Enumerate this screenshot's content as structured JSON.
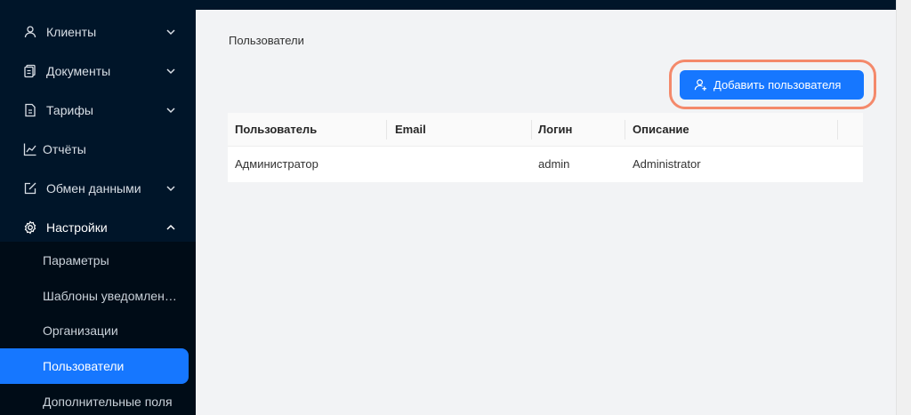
{
  "sidebar": {
    "items": [
      {
        "label": "Клиенты",
        "icon": "user-icon",
        "chevron": "chevron-down-icon"
      },
      {
        "label": "Документы",
        "icon": "document-icon",
        "chevron": "chevron-down-icon"
      },
      {
        "label": "Тарифы",
        "icon": "tariff-icon",
        "chevron": "chevron-down-icon"
      },
      {
        "label": "Отчёты",
        "icon": "line-chart-icon"
      },
      {
        "label": "Обмен данными",
        "icon": "edit-icon",
        "chevron": "chevron-down-icon"
      },
      {
        "label": "Настройки",
        "icon": "gear-icon",
        "chevron": "chevron-up-icon"
      }
    ],
    "submenu": [
      {
        "label": "Параметры"
      },
      {
        "label": "Шаблоны уведомлений"
      },
      {
        "label": "Организации"
      },
      {
        "label": "Пользователи",
        "active": true
      },
      {
        "label": "Дополнительные поля"
      }
    ]
  },
  "main": {
    "title": "Пользователи",
    "add_button": {
      "label": "Добавить пользователя",
      "icon": "user-add-icon"
    }
  },
  "table": {
    "columns": [
      "Пользователь",
      "Email",
      "Логин",
      "Описание"
    ],
    "rows": [
      [
        "Администратор",
        "",
        "admin",
        "Administrator"
      ]
    ]
  },
  "colors": {
    "sidebar_bg": "#001529",
    "accent": "#1677ff",
    "highlight": "#f4896b",
    "content_bg": "#f2f3f5"
  }
}
